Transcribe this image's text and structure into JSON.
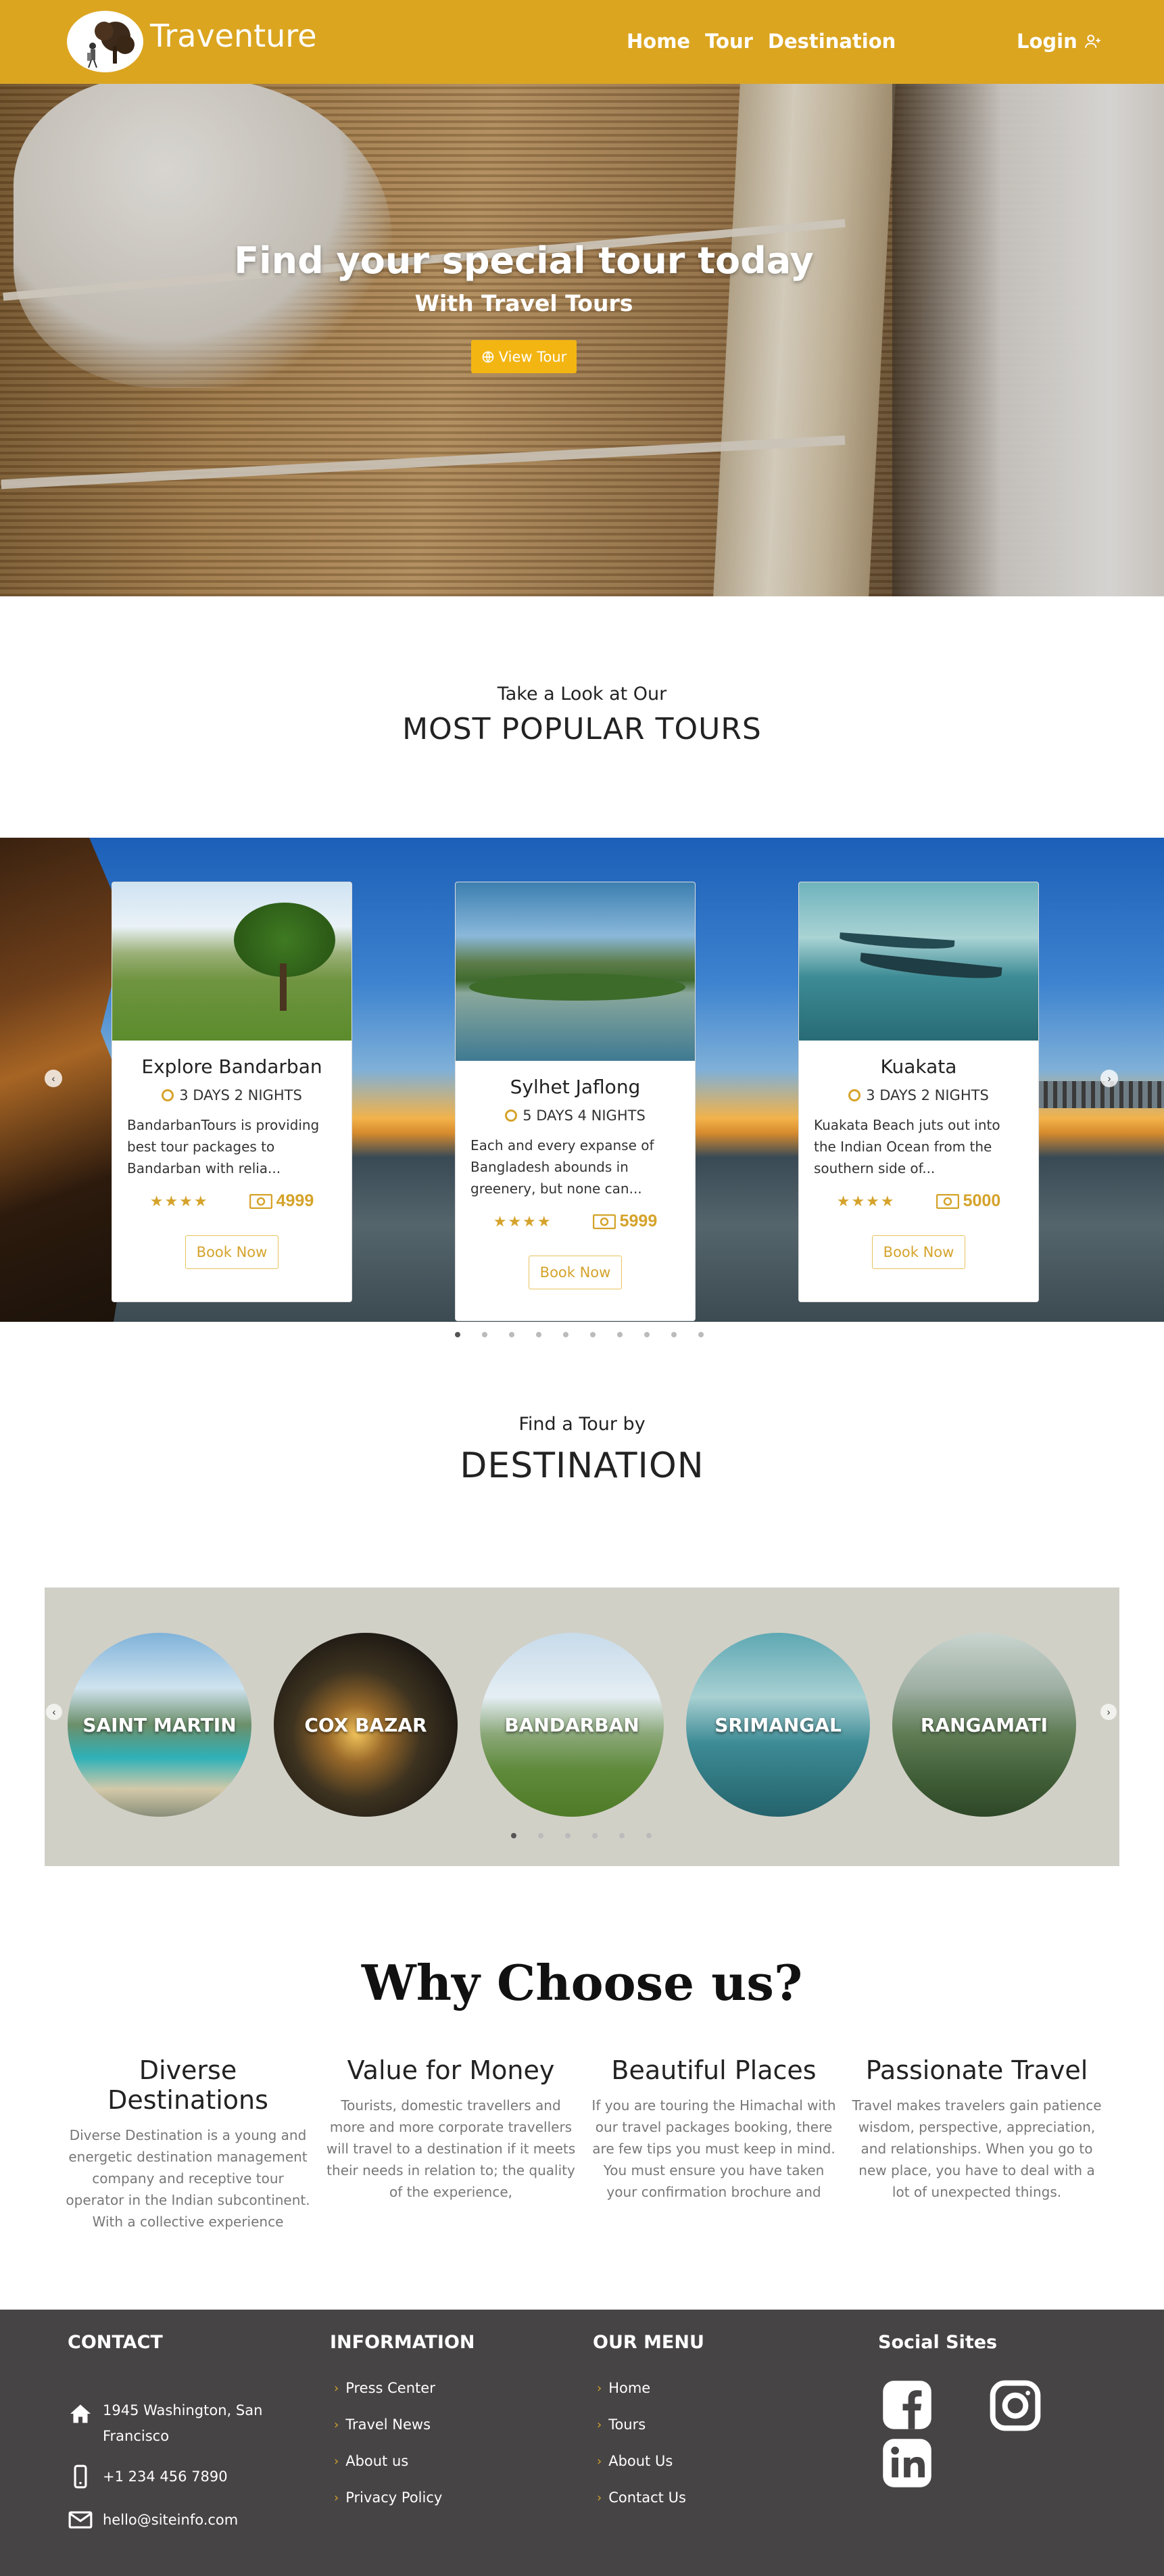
{
  "brand": {
    "name": "Traventure"
  },
  "nav": {
    "links": [
      "Home",
      "Tour",
      "Destination"
    ],
    "login": "Login"
  },
  "hero": {
    "title": "Find your special tour today",
    "subtitle": "With Travel Tours",
    "button": "View Tour"
  },
  "popular": {
    "kicker": "Take a Look at Our",
    "heading": "MOST POPULAR TOURS",
    "tours": [
      {
        "title": "Explore Bandarban",
        "days": "3 DAYS 2 NIGHTS",
        "desc": "BandarbanTours is providing best tour packages to Bandarban with relia...",
        "stars": "★★★★",
        "price": "4999",
        "button": "Book Now"
      },
      {
        "title": "Sylhet Jaflong",
        "days": "5 DAYS 4 NIGHTS",
        "desc": "Each and every expanse of Bangladesh abounds in greenery, but none can...",
        "stars": "★★★★",
        "price": "5999",
        "button": "Book Now"
      },
      {
        "title": "Kuakata",
        "days": "3 DAYS 2 NIGHTS",
        "desc": "Kuakata Beach juts out into the Indian Ocean from the southern side of...",
        "stars": "★★★★",
        "price": "5000",
        "button": "Book Now"
      }
    ],
    "dot_count": 10,
    "active_dot": 0
  },
  "destination": {
    "kicker": "Find a Tour by",
    "heading": "DESTINATION",
    "places": [
      "SAINT MARTIN",
      "COX BAZAR",
      "BANDARBAN",
      "SRIMANGAL",
      "RANGAMATI"
    ],
    "dot_count": 6,
    "active_dot": 0
  },
  "why": {
    "title": "Why Choose us?",
    "items": [
      {
        "head": "Diverse Destinations",
        "text": "Diverse Destination is a young and energetic destination management company and receptive tour operator in the Indian subcontinent. With a collective experience"
      },
      {
        "head": "Value for Money",
        "text": "Tourists, domestic travellers and more and more corporate travellers will travel to a destination if it meets their needs in relation to; the quality of the experience,"
      },
      {
        "head": "Beautiful Places",
        "text": "If you are touring the Himachal with our travel packages booking, there are few tips you must keep in mind. You must ensure you have taken your confirmation brochure and"
      },
      {
        "head": "Passionate Travel",
        "text": "Travel makes travelers gain patience wisdom, perspective, appreciation, and relationships. When you go to new place, you have to deal with a lot of unexpected things."
      }
    ]
  },
  "footer": {
    "contact": {
      "head": "CONTACT",
      "address": "1945 Washington, San Francisco",
      "phone": "+1 234 456 7890",
      "email": "hello@siteinfo.com"
    },
    "information": {
      "head": "INFORMATION",
      "links": [
        "Press Center",
        "Travel News",
        "About us",
        "Privacy Policy"
      ]
    },
    "menu": {
      "head": "OUR MENU",
      "links": [
        "Home",
        "Tours",
        "About Us",
        "Contact Us"
      ]
    },
    "social": {
      "head": "Social Sites",
      "icons": [
        "facebook-icon",
        "instagram-icon",
        "linkedin-icon"
      ]
    }
  },
  "colors": {
    "accent": "#dba520",
    "button": "#f3b512",
    "gold_text": "#d5a32b",
    "footer_bg": "#464445",
    "dest_panel": "#d1d0c7"
  }
}
